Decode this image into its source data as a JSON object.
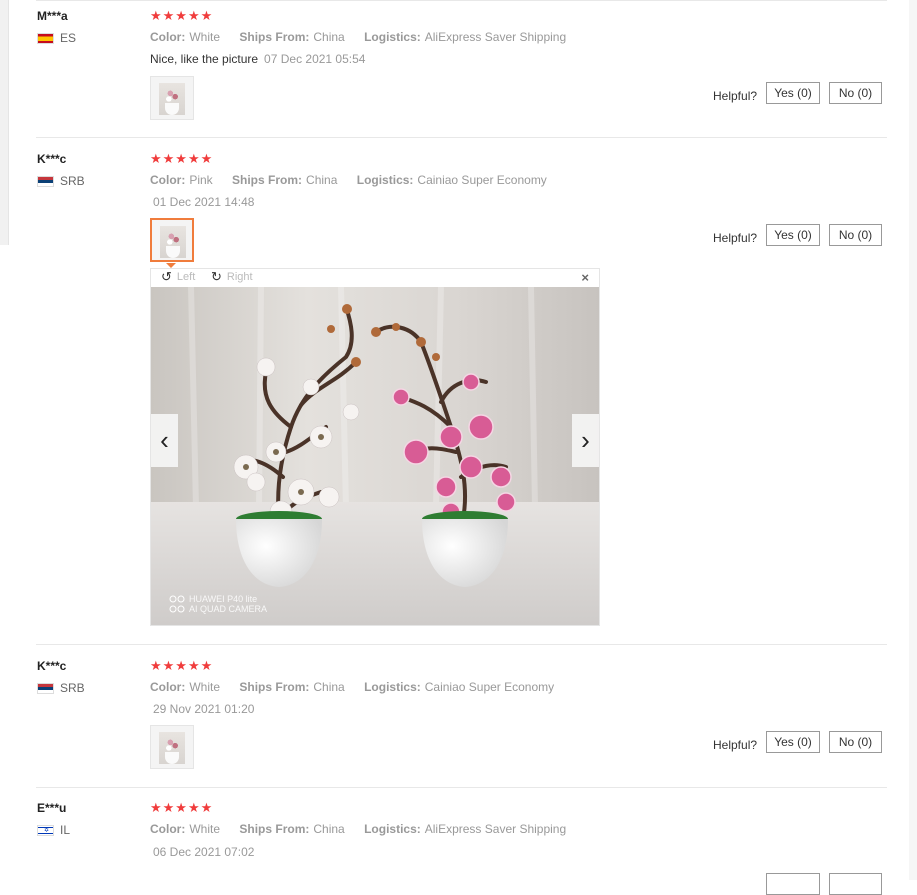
{
  "labels": {
    "color": "Color:",
    "ships_from": "Ships From:",
    "logistics": "Logistics:",
    "helpful": "Helpful?"
  },
  "stars": "★★★★★",
  "reviews": [
    {
      "user": "M***a",
      "country": "ES",
      "color": "White",
      "ships_from": "China",
      "logistics": "AliExpress Saver Shipping",
      "feedback": "Nice, like the picture",
      "date": "07 Dec 2021 05:54",
      "yes": "Yes (0)",
      "no": "No (0)"
    },
    {
      "user": "K***c",
      "country": "SRB",
      "color": "Pink",
      "ships_from": "China",
      "logistics": "Cainiao Super Economy",
      "date": "01 Dec 2021 14:48",
      "yes": "Yes (0)",
      "no": "No (0)"
    },
    {
      "user": "K***c",
      "country": "SRB",
      "color": "White",
      "ships_from": "China",
      "logistics": "Cainiao Super Economy",
      "date": "29 Nov 2021 01:20",
      "yes": "Yes (0)",
      "no": "No (0)"
    },
    {
      "user": "E***u",
      "country": "IL",
      "color": "White",
      "ships_from": "China",
      "logistics": "AliExpress Saver Shipping",
      "date": "06 Dec 2021 07:02"
    }
  ],
  "viewer": {
    "rotate_left": "Left",
    "rotate_right": "Right",
    "close": "×",
    "prev": "‹",
    "next": "›",
    "watermark_line1": "HUAWEI P40 lite",
    "watermark_line2": "AI QUAD CAMERA"
  },
  "icons": [
    "rotate-left-icon",
    "rotate-right-icon",
    "close-icon",
    "chevron-left-icon",
    "chevron-right-icon",
    "flag-es-icon",
    "flag-srb-icon",
    "flag-il-icon"
  ],
  "colors": {
    "star": "#f03c3c",
    "active_thumb": "#f07c3c",
    "muted_text": "#999999"
  }
}
